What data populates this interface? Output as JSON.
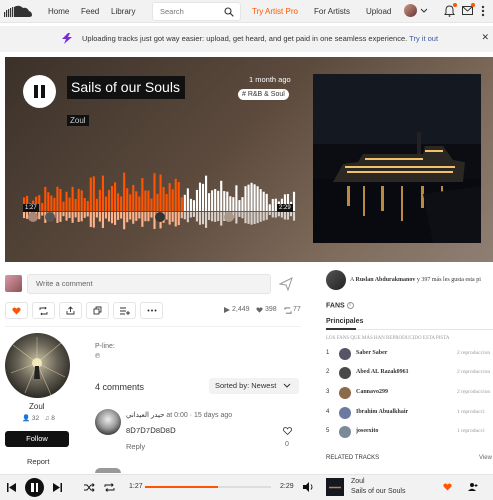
{
  "nav": {
    "links": [
      "Home",
      "Feed",
      "Library"
    ],
    "search_placeholder": "Search",
    "try_pro": "Try Artist Pro",
    "for_artists": "For Artists",
    "upload": "Upload"
  },
  "banner": {
    "text": "Uploading tracks just got way easier: upload, get heard, and get paid in one seamless experience.",
    "link": "Try it out"
  },
  "track": {
    "title": "Sails of our Souls",
    "artist": "Zoul",
    "posted": "1 month ago",
    "genre": "# R&B & Soul",
    "time_current": "1:27",
    "time_total": "2:29",
    "progress": 0.58
  },
  "comment_box": {
    "placeholder": "Write a comment"
  },
  "stats": {
    "plays": "2,449",
    "likes": "398",
    "reposts": "77"
  },
  "artist_card": {
    "name": "Zoul",
    "followers": "32",
    "tracks": "8",
    "follow": "Follow",
    "report": "Report"
  },
  "meta": {
    "pline": "P-line:",
    "pmark": "℗"
  },
  "comments": {
    "count_label": "4 comments",
    "sort_label": "Sorted by: Newest",
    "items": [
      {
        "user": "حيدر العيداني",
        "at": "at 0:00",
        "when": "· 15 days ago",
        "body": "8ᗞ7ᗞ7ᗞ8ᗞ8ᗞ",
        "reply": "Reply",
        "likes": "0"
      }
    ]
  },
  "sidebar": {
    "liked_by_prefix": "A",
    "liked_by_user": "Ruslan Abdurakmanov",
    "liked_by_suffix": "y 397 más les gusta esta pi",
    "fans_title": "FANS",
    "tab": "Principales",
    "fans_subtitle": "LOS FANS QUE MÁS HAN REPRODUCIDO ESTA PISTA",
    "fans": [
      {
        "num": "1",
        "name": "Saber Saber",
        "plays": "2 reproduccion",
        "color": "#556"
      },
      {
        "num": "2",
        "name": "Abed AL Razak0961",
        "plays": "2 reproduccion",
        "color": "#4a4a4a"
      },
      {
        "num": "3",
        "name": "Cannavo299",
        "plays": "2 reproduccion",
        "color": "#8a6a4a"
      },
      {
        "num": "4",
        "name": "Ibrahim Abualkhair",
        "plays": "1 reproducci",
        "color": "#6a7aa0"
      },
      {
        "num": "5",
        "name": "joseexito",
        "plays": "1 reproducci",
        "color": "#7a8a99"
      }
    ],
    "related": "RELATED TRACKS",
    "view_all": "View"
  },
  "player": {
    "time_current": "1:27",
    "time_total": "2:29",
    "progress": 0.58,
    "artist": "Zoul",
    "title": "Sails of our Souls"
  },
  "colors": {
    "accent": "#ff5500",
    "dark": "#111111"
  }
}
